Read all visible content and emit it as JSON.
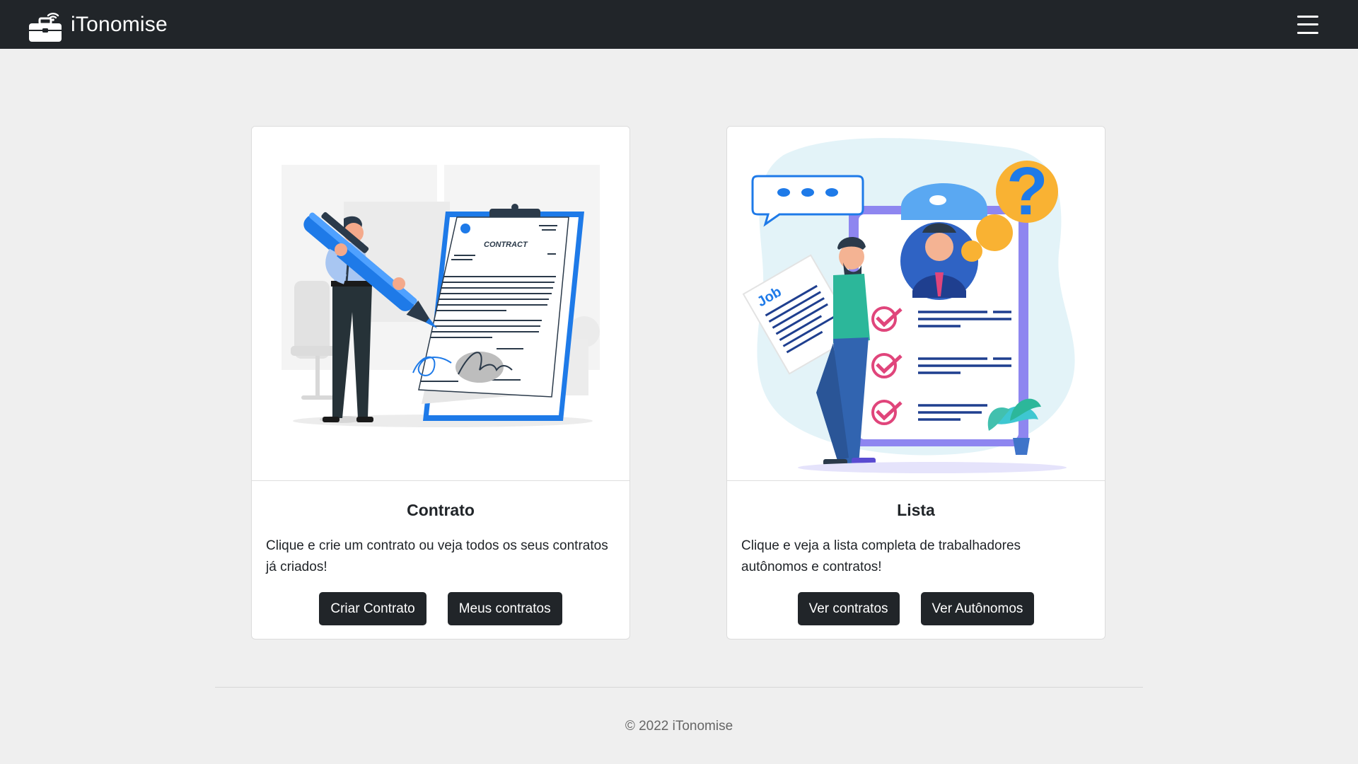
{
  "navbar": {
    "brand_name": "iTonomise",
    "logo_icon": "briefcase-wifi-icon",
    "menu_icon": "hamburger-menu-icon"
  },
  "cards": [
    {
      "title": "Contrato",
      "text": "Clique e crie um contrato ou veja todos os seus contratos já criados!",
      "illustration_label": "CONTRACT",
      "buttons": [
        "Criar Contrato",
        "Meus contratos"
      ]
    },
    {
      "title": "Lista",
      "text": "Clique e veja a lista completa de trabalhadores autônomos e contratos!",
      "illustration_label": "Job",
      "buttons": [
        "Ver contratos",
        "Ver Autônomos"
      ]
    }
  ],
  "footer": {
    "text": "© 2022 iTonomise"
  },
  "colors": {
    "navbar_bg": "#212529",
    "page_bg": "#efefef",
    "button_bg": "#212529",
    "accent_blue": "#1e7ae8",
    "accent_orange": "#f9b233",
    "accent_pink": "#e0457b"
  }
}
